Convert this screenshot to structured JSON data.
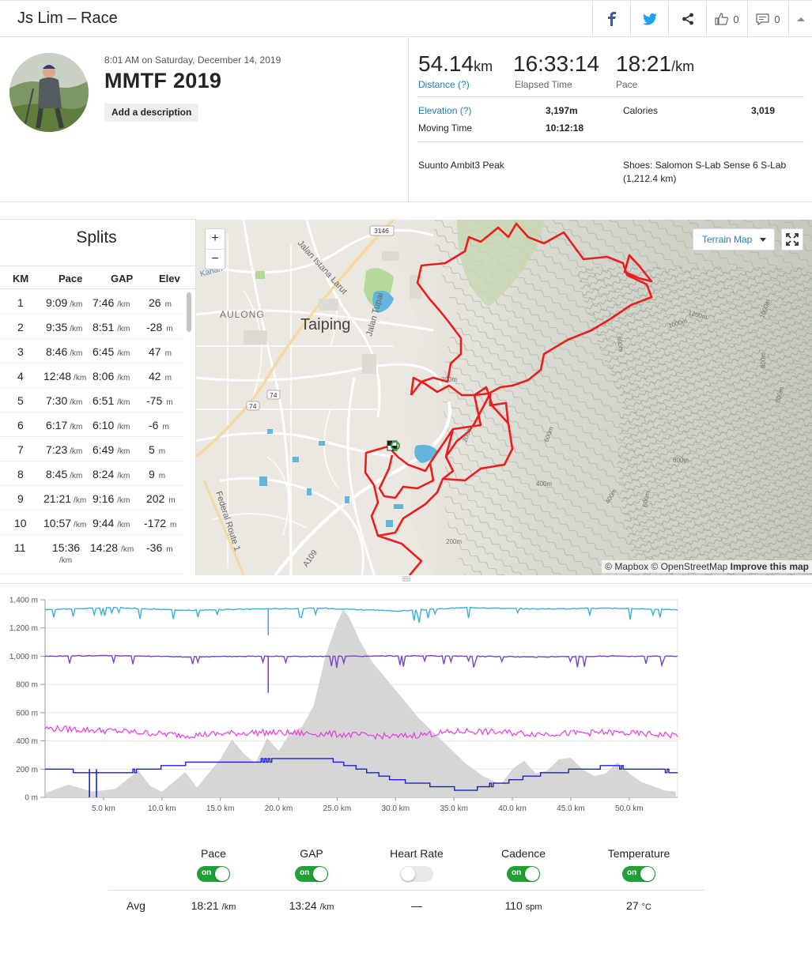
{
  "header": {
    "title": "Js Lim – Race",
    "kudos_count": "0",
    "comments_count": "0",
    "icons": [
      "facebook-icon",
      "twitter-icon",
      "share-icon",
      "thumbs-up-icon",
      "comment-icon",
      "chevron-up-icon"
    ]
  },
  "activity": {
    "date": "8:01 AM on Saturday, December 14, 2019",
    "name": "MMTF 2019",
    "description_button": "Add a description"
  },
  "stats": {
    "distance": {
      "value": "54.14",
      "unit": "km",
      "label": "Distance (?)"
    },
    "elapsed": {
      "value": "16:33:14",
      "label": "Elapsed Time"
    },
    "pace": {
      "value": "18:21",
      "unit": "/km",
      "label": "Pace"
    },
    "elevation": {
      "label": "Elevation (?)",
      "value": "3,197m"
    },
    "moving_time": {
      "label": "Moving Time",
      "value": "10:12:18"
    },
    "calories": {
      "label": "Calories",
      "value": "3,019"
    },
    "device": "Suunto Ambit3 Peak",
    "shoes_line1": "Shoes: Salomon S-Lab Sense 6 S-Lab",
    "shoes_line2": "(1,212.4 km)"
  },
  "splits": {
    "title": "Splits",
    "headers": [
      "KM",
      "Pace",
      "GAP",
      "Elev"
    ],
    "pace_unit": "/km",
    "elev_unit": "m",
    "rows": [
      {
        "km": "1",
        "pace": "9:09",
        "gap": "7:46",
        "elev": "26"
      },
      {
        "km": "2",
        "pace": "9:35",
        "gap": "8:51",
        "elev": "-28"
      },
      {
        "km": "3",
        "pace": "8:46",
        "gap": "6:45",
        "elev": "47"
      },
      {
        "km": "4",
        "pace": "12:48",
        "gap": "8:06",
        "elev": "42"
      },
      {
        "km": "5",
        "pace": "7:30",
        "gap": "6:51",
        "elev": "-75"
      },
      {
        "km": "6",
        "pace": "6:17",
        "gap": "6:10",
        "elev": "-6"
      },
      {
        "km": "7",
        "pace": "7:23",
        "gap": "6:49",
        "elev": "5"
      },
      {
        "km": "8",
        "pace": "8:45",
        "gap": "8:24",
        "elev": "9"
      },
      {
        "km": "9",
        "pace": "21:21",
        "gap": "9:16",
        "elev": "202"
      },
      {
        "km": "10",
        "pace": "10:57",
        "gap": "9:44",
        "elev": "-172"
      },
      {
        "km": "11",
        "pace": "15:36",
        "gap": "14:28",
        "elev": "-36"
      }
    ]
  },
  "map": {
    "zoom_in": "+",
    "zoom_out": "−",
    "map_type": "Terrain Map",
    "attribution_plain": "© Mapbox © OpenStreetMap ",
    "attribution_link": "Improve this map",
    "labels": {
      "city": "Taiping",
      "district": "AULONG",
      "road1": "Jalan Istana Larut",
      "road2": "Jalan Tupai",
      "road3": "Federal Route 1",
      "road4": "A109",
      "road5": "Kanan",
      "shield1": "3146",
      "shield2": "74",
      "shield3": "74",
      "c1": "1200m",
      "c2": "1000m",
      "c3": "1000m",
      "c4": "800m",
      "c5": "800m",
      "c6": "800m",
      "c7": "600m",
      "c8": "600m",
      "c9": "600m",
      "c10": "400m",
      "c11": "400m",
      "c12": "200m",
      "c13": "200m",
      "c14": "200m"
    }
  },
  "chart_data": {
    "type": "line",
    "ylabel_ticks": [
      "0 m",
      "200 m",
      "400 m",
      "600 m",
      "800 m",
      "1,000 m",
      "1,200 m",
      "1,400 m"
    ],
    "xlabel_ticks": [
      "5.0 km",
      "10.0 km",
      "15.0 km",
      "20.0 km",
      "25.0 km",
      "30.0 km",
      "35.0 km",
      "40.0 km",
      "45.0 km",
      "50.0 km"
    ],
    "ylim": [
      0,
      1400
    ],
    "xlim": [
      0,
      54.14
    ],
    "elevation_profile": {
      "x": [
        0,
        2,
        4,
        6,
        8,
        9,
        10,
        12,
        13,
        15,
        16,
        17,
        18,
        19,
        20,
        21,
        22,
        23,
        24,
        25,
        25.5,
        26,
        27,
        28,
        30,
        32,
        34,
        36,
        37.5,
        39,
        40,
        41,
        42,
        43,
        44,
        45,
        46,
        47,
        48,
        49,
        50,
        51,
        52,
        53,
        54
      ],
      "values": [
        30,
        90,
        40,
        60,
        190,
        80,
        40,
        180,
        70,
        270,
        410,
        310,
        240,
        420,
        330,
        460,
        500,
        650,
        1000,
        1240,
        1330,
        1280,
        1100,
        960,
        760,
        560,
        400,
        240,
        150,
        90,
        200,
        260,
        170,
        190,
        270,
        280,
        200,
        150,
        170,
        250,
        170,
        110,
        80,
        50,
        40
      ]
    },
    "series": [
      {
        "name": "",
        "color": "#3aaee0",
        "values": [
          1330,
          1345,
          1325,
          1335,
          1340,
          1320,
          1345,
          1335,
          1340,
          1330
        ]
      },
      {
        "name": "",
        "color": "#7a44c8",
        "values": [
          1000,
          1005,
          995,
          1000,
          998,
          1002,
          1000,
          995,
          1000,
          1000
        ]
      },
      {
        "name": "",
        "color": "#e83ae3",
        "values": [
          490,
          470,
          440,
          460,
          450,
          430,
          470,
          450,
          460,
          440
        ]
      },
      {
        "name": "",
        "color": "#1c1fd8",
        "values": [
          200,
          170,
          240,
          260,
          280,
          120,
          50,
          160,
          220,
          180
        ]
      }
    ],
    "grid": true
  },
  "legend": {
    "columns": [
      {
        "name": "Pace",
        "on": true,
        "avg": "18:21",
        "unit": "/km"
      },
      {
        "name": "GAP",
        "on": true,
        "avg": "13:24",
        "unit": "/km"
      },
      {
        "name": "Heart Rate",
        "on": false,
        "avg": "—",
        "unit": ""
      },
      {
        "name": "Cadence",
        "on": true,
        "avg": "110",
        "unit": "spm"
      },
      {
        "name": "Temperature",
        "on": true,
        "avg": "27",
        "unit": "°C"
      }
    ],
    "toggle_on_text": "on",
    "avg_label": "Avg"
  }
}
